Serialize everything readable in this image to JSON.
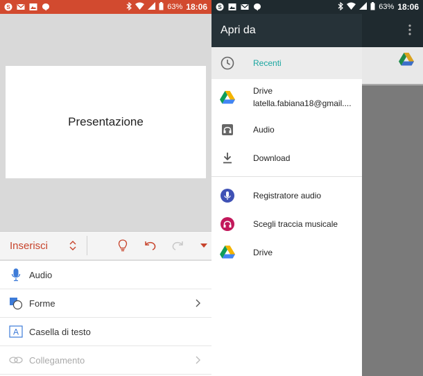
{
  "colors": {
    "office_accent": "#c7432b",
    "left_statusbar": "#d24a2f",
    "right_statusbar": "#1f2a2f",
    "drawer_header": "#263238",
    "selected_text": "#1aa6a0"
  },
  "left": {
    "status": {
      "battery": "63%",
      "time": "18:06"
    },
    "slide_title": "Presentazione",
    "toolbar": {
      "mode_label": "Inserisci"
    },
    "menu": [
      {
        "label": "Audio",
        "icon": "microphone-icon",
        "enabled": true,
        "has_chevron": false
      },
      {
        "label": "Forme",
        "icon": "shapes-icon",
        "enabled": true,
        "has_chevron": true
      },
      {
        "label": "Casella di testo",
        "icon": "textbox-icon",
        "enabled": true,
        "has_chevron": false
      },
      {
        "label": "Collegamento",
        "icon": "link-icon",
        "enabled": false,
        "has_chevron": true
      }
    ]
  },
  "right": {
    "status": {
      "battery": "63%",
      "time": "18:06"
    },
    "drawer": {
      "title": "Apri da",
      "items": [
        {
          "label": "Recenti",
          "icon": "clock-icon",
          "selected": true
        },
        {
          "label": "Drive",
          "sub": "latella.fabiana18@gmail....",
          "icon": "google-drive-icon"
        },
        {
          "label": "Audio",
          "icon": "headphones-icon"
        },
        {
          "label": "Download",
          "icon": "download-icon"
        },
        {
          "label": "Registratore audio",
          "icon": "voice-recorder-icon"
        },
        {
          "label": "Scegli traccia musicale",
          "icon": "music-headphones-icon"
        },
        {
          "label": "Drive",
          "icon": "google-drive-icon"
        }
      ]
    }
  }
}
